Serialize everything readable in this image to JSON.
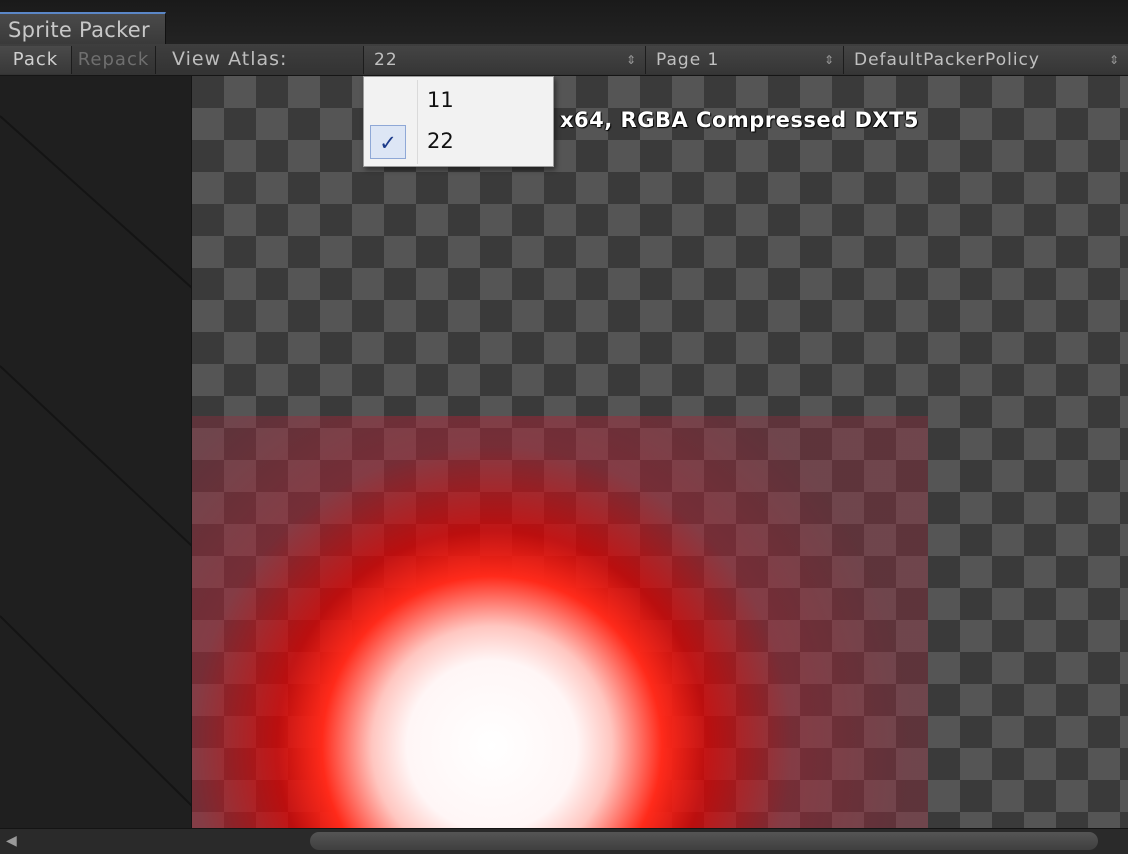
{
  "window": {
    "tab_title": "Sprite Packer"
  },
  "toolbar": {
    "pack_label": "Pack",
    "repack_label": "Repack",
    "view_atlas_label": "View Atlas:",
    "atlas_value": "22",
    "page_value": "Page 1",
    "policy_value": "DefaultPackerPolicy"
  },
  "atlas_menu": {
    "items": [
      {
        "label": "11",
        "checked": false
      },
      {
        "label": "22",
        "checked": true
      }
    ],
    "checkmark": "✓"
  },
  "viewport": {
    "info_text": "x64, RGBA Compressed DXT5",
    "sprite_color": "#ff2a1a"
  },
  "popup_arrow": "⇕",
  "scroll_arrow": "◀"
}
